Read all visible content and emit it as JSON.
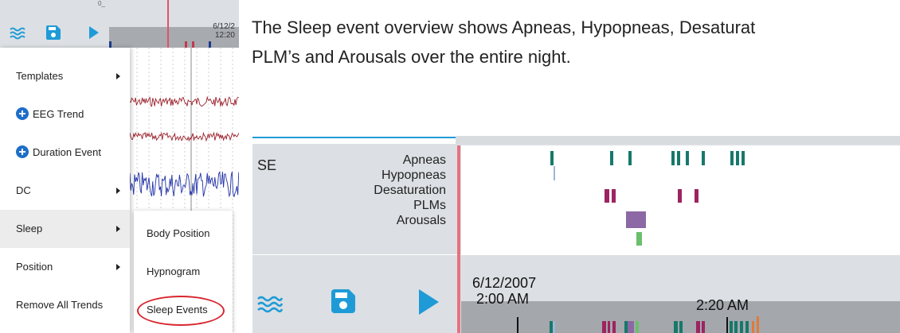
{
  "left": {
    "tiny_label": "0_",
    "timestamp_date": "6/12/2",
    "timestamp_time": "12:20",
    "menu": {
      "items": [
        {
          "label": "Templates"
        },
        {
          "label": "EEG Trend"
        },
        {
          "label": "Duration Event"
        },
        {
          "label": "DC"
        },
        {
          "label": "Sleep"
        },
        {
          "label": "Position"
        },
        {
          "label": "Remove All Trends"
        }
      ]
    },
    "submenu": {
      "items": [
        {
          "label": "Body Position"
        },
        {
          "label": "Hypnogram"
        },
        {
          "label": "Sleep Events"
        }
      ]
    }
  },
  "description": {
    "line1": "The Sleep event overview shows Apneas, Hypopneas, Desaturat",
    "line2": "PLM’s and Arousals over the entire night."
  },
  "right": {
    "panel_label": "SE",
    "rows": [
      "Apneas",
      "Hypopneas",
      "Desaturation",
      "PLMs",
      "Arousals"
    ],
    "bottom_date": "6/12/2007",
    "time_label_1": "2:00 AM",
    "time_label_2": "2:20 AM"
  },
  "colors": {
    "apnea": "#17786b",
    "hypopnea": "#9fb6d6",
    "desaturation": "#9c2461",
    "plm": "#8c68a4",
    "arousal": "#6cbf6c",
    "accent_blue": "#1e9bd7",
    "red_line": "#e5737f",
    "highlight_circle": "#d8262f"
  },
  "icons": [
    "waves-icon",
    "save-icon",
    "play-icon",
    "chevron-right-icon",
    "plus-circle-icon"
  ]
}
